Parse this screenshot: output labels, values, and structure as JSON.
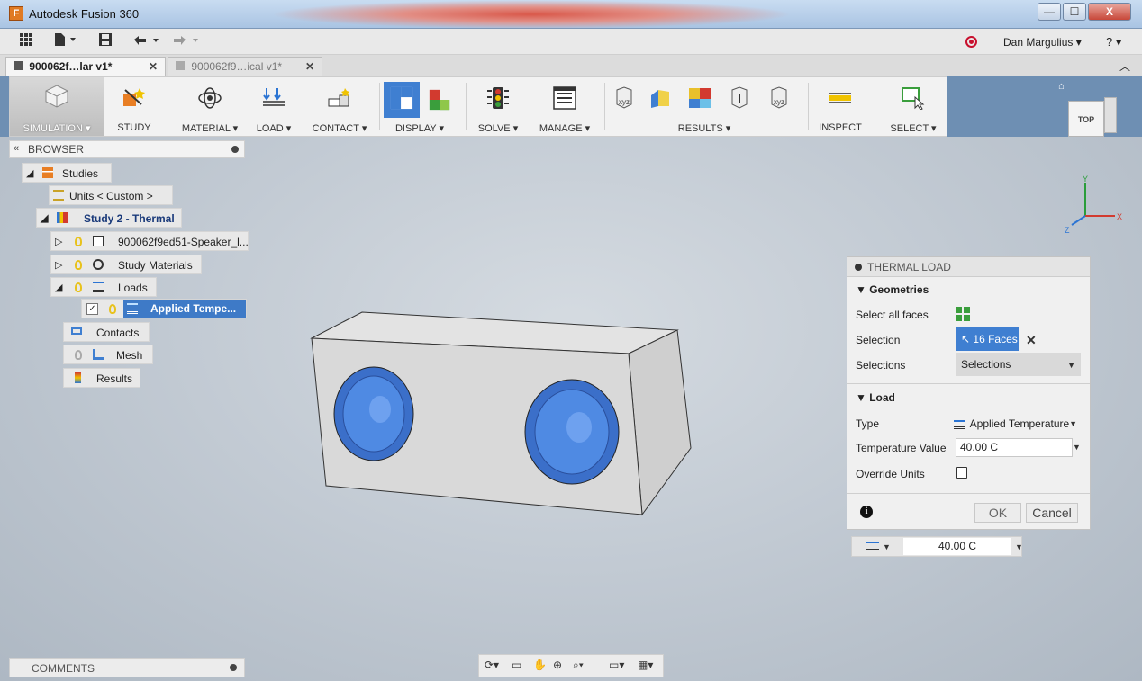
{
  "window": {
    "title": "Autodesk Fusion 360",
    "app_icon": "fusion-logo-icon",
    "min": "—",
    "max": "☐",
    "close": "X"
  },
  "menubar": {
    "user": "Dan Margulius ▾",
    "help": "? ▾"
  },
  "tabs": [
    {
      "label": "900062f…lar v1*",
      "close": "✕"
    },
    {
      "label": "900062f9…ical v1*",
      "close": "✕"
    }
  ],
  "toolbar": {
    "simulation": "SIMULATION ▾",
    "study": "STUDY",
    "material": "MATERIAL ▾",
    "load": "LOAD ▾",
    "contact": "CONTACT ▾",
    "display": "DISPLAY ▾",
    "solve": "SOLVE ▾",
    "manage": "MANAGE ▾",
    "results": "RESULTS ▾",
    "inspect": "INSPECT",
    "select": "SELECT ▾"
  },
  "viewcube": {
    "face": "TOP"
  },
  "axes": {
    "y": "Y",
    "x": "X",
    "z": "Z"
  },
  "browser": {
    "header": "BROWSER",
    "items": {
      "studies": "Studies",
      "units": "Units < Custom >",
      "study2": "Study 2 - Thermal",
      "component": "900062f9ed51-Speaker_l...",
      "materials": "Study Materials",
      "loads": "Loads",
      "applied": "Applied Tempe...",
      "contacts": "Contacts",
      "mesh": "Mesh",
      "results": "Results"
    }
  },
  "dialog": {
    "title": "THERMAL LOAD",
    "geometries": "▼ Geometries",
    "select_all_faces": "Select all faces",
    "selection_label": "Selection",
    "selection_value": "16 Faces",
    "selections_label": "Selections",
    "selections_value": "Selections",
    "load": "▼ Load",
    "type_label": "Type",
    "type_value": "Applied Temperature",
    "temp_label": "Temperature Value",
    "temp_value": "40.00 C",
    "override_label": "Override Units",
    "ok": "OK",
    "cancel": "Cancel",
    "info": "i"
  },
  "minibar": {
    "value": "40.00 C"
  },
  "comments": {
    "label": "COMMENTS"
  },
  "colors": {
    "accent": "#3f7fd1",
    "speaker": "#3b78d8",
    "viewport_top": "#bcc6d0",
    "viewport_bottom": "#ffffff"
  }
}
